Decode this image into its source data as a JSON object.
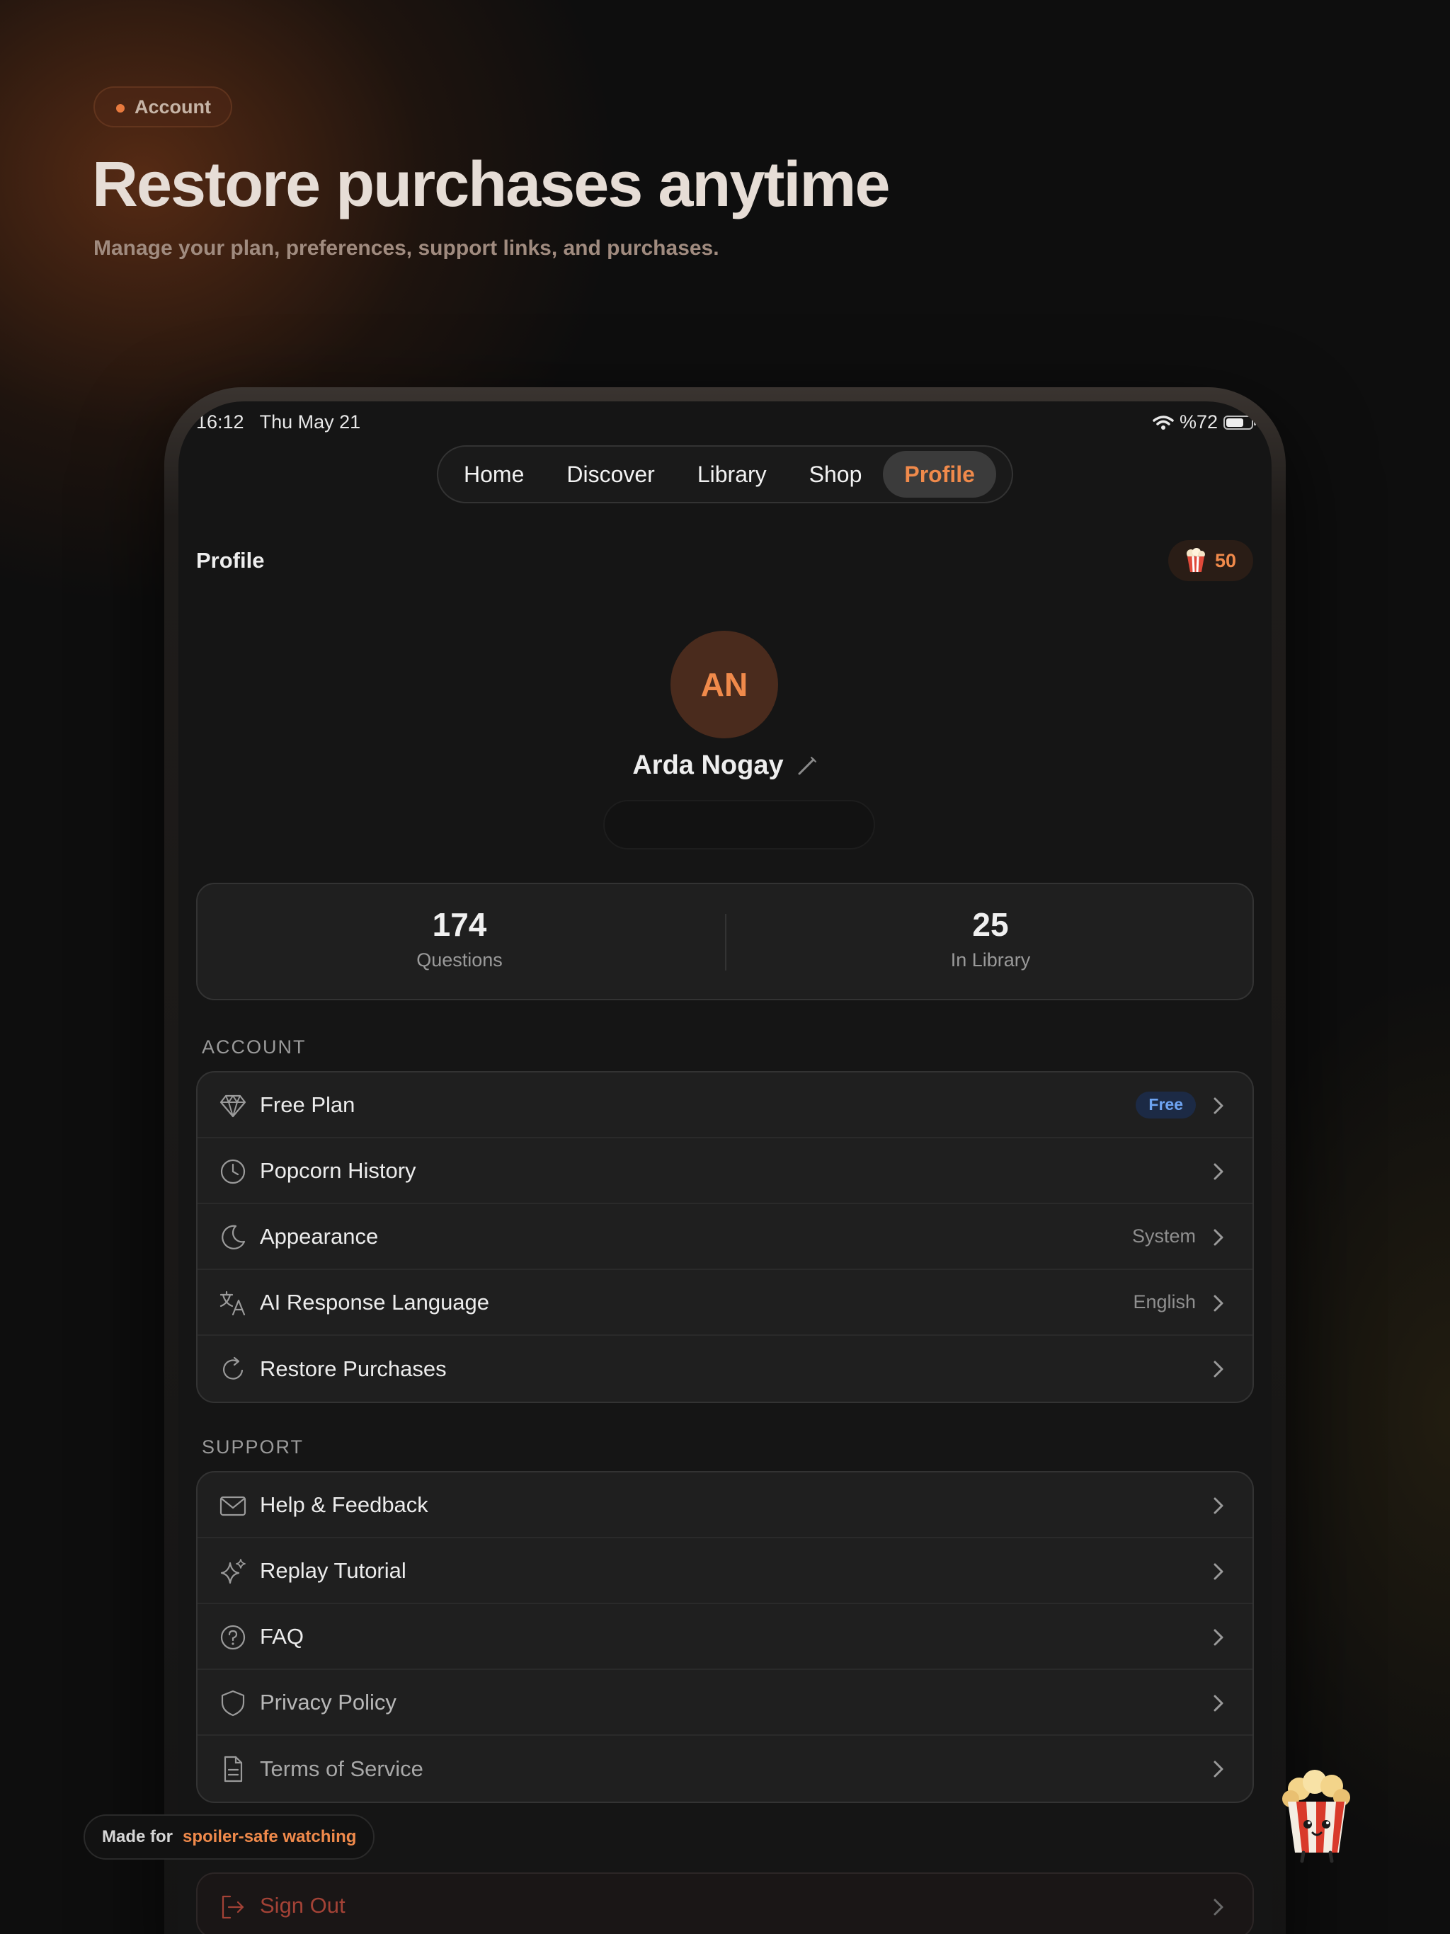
{
  "hero": {
    "pill_label": "Account",
    "title": "Restore purchases anytime",
    "subtitle": "Manage your plan, preferences, support links, and purchases."
  },
  "status_bar": {
    "time": "16:12",
    "date": "Thu May 21",
    "battery": "%72",
    "battery_level": 0.72
  },
  "tabs": [
    {
      "label": "Home",
      "active": false
    },
    {
      "label": "Discover",
      "active": false
    },
    {
      "label": "Library",
      "active": false
    },
    {
      "label": "Shop",
      "active": false
    },
    {
      "label": "Profile",
      "active": true
    }
  ],
  "header": {
    "title": "Profile",
    "popcorn_count": "50"
  },
  "user": {
    "initials": "AN",
    "name": "Arda Nogay"
  },
  "stats": [
    {
      "value": "174",
      "label": "Questions"
    },
    {
      "value": "25",
      "label": "In Library"
    }
  ],
  "account": {
    "section_label": "ACCOUNT",
    "items": [
      {
        "icon": "diamond-icon",
        "label": "Free Plan",
        "badge": "Free"
      },
      {
        "icon": "clock-icon",
        "label": "Popcorn History"
      },
      {
        "icon": "moon-icon",
        "label": "Appearance",
        "value": "System"
      },
      {
        "icon": "translate-icon",
        "label": "AI Response Language",
        "value": "English"
      },
      {
        "icon": "refresh-icon",
        "label": "Restore Purchases"
      }
    ]
  },
  "support": {
    "section_label": "SUPPORT",
    "items": [
      {
        "icon": "mail-icon",
        "label": "Help & Feedback"
      },
      {
        "icon": "sparkles-icon",
        "label": "Replay Tutorial"
      },
      {
        "icon": "question-icon",
        "label": "FAQ"
      },
      {
        "icon": "shield-icon",
        "label": "Privacy Policy"
      },
      {
        "icon": "document-icon",
        "label": "Terms of Service"
      }
    ]
  },
  "sign_out": {
    "icon": "logout-icon",
    "label": "Sign Out"
  },
  "footer": {
    "made_for": "Made for",
    "tagline": "spoiler-safe watching"
  },
  "colors": {
    "accent": "#f08a4b",
    "badge_blue": "#6ea4f2",
    "danger": "#a34236"
  }
}
